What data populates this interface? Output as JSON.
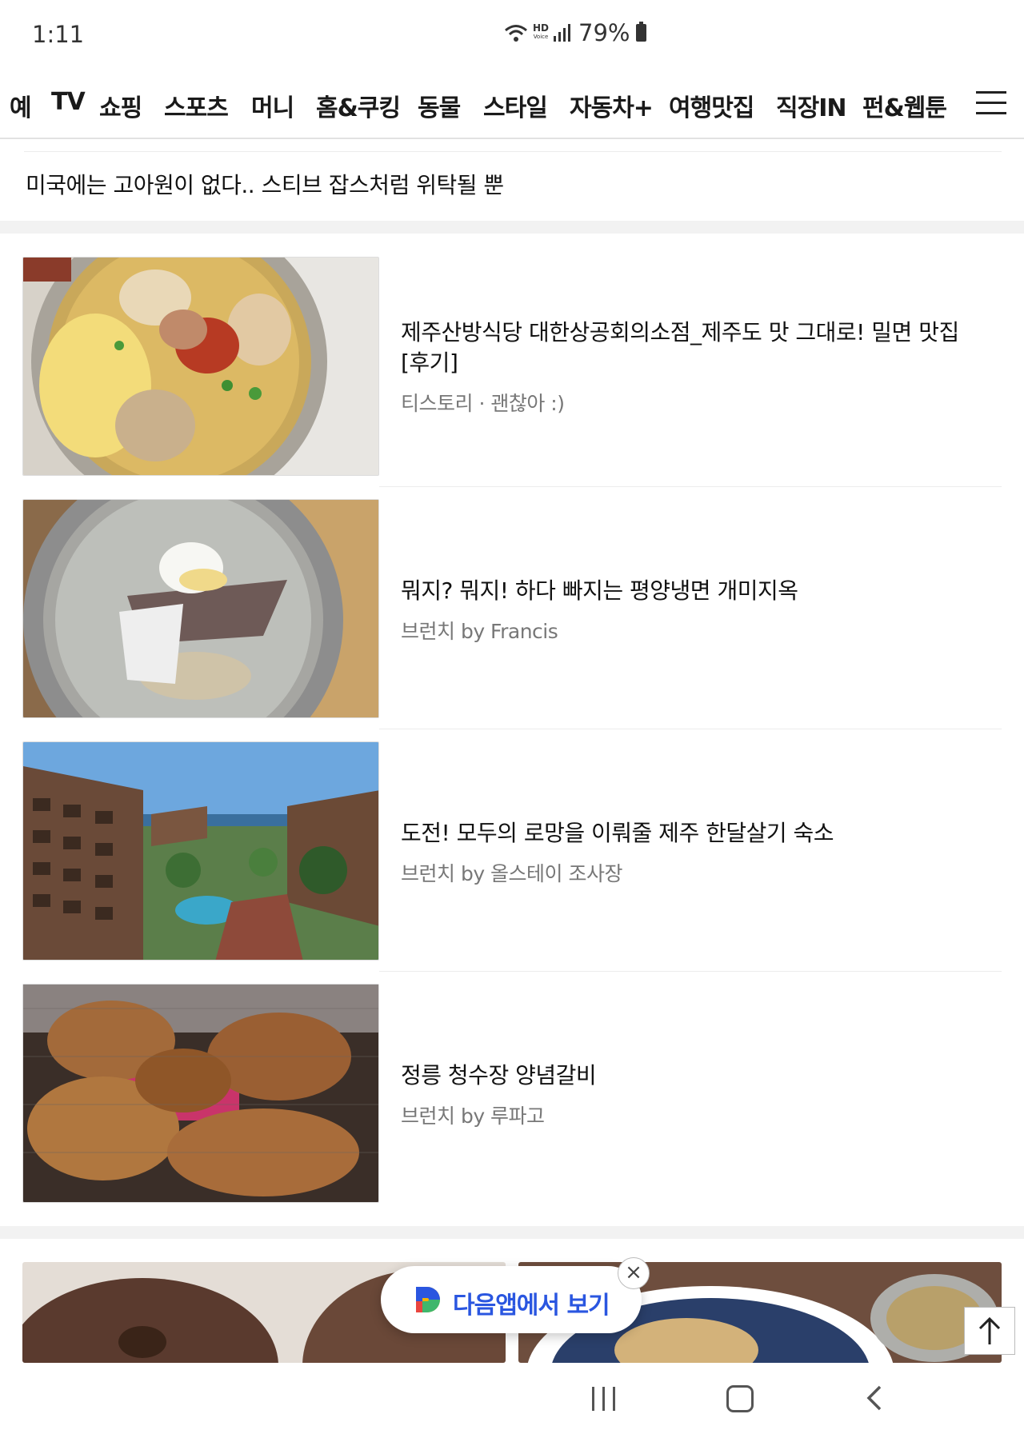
{
  "status_bar": {
    "time": "1:11",
    "hd_label": "HD",
    "hd_sub": "Voice",
    "battery": "79%"
  },
  "nav": {
    "partial_item": "예",
    "items": [
      "TV",
      "쇼핑",
      "스포츠",
      "머니",
      "홈&쿠킹",
      "동물",
      "스타일",
      "자동차+",
      "여행맛집",
      "직장IN",
      "펀&웹툰"
    ],
    "active": "여행맛집",
    "menu_icon": "hamburger-icon"
  },
  "headline": "미국에는 고아원이 없다.. 스티브 잡스처럼 위탁될 뿐",
  "articles": [
    {
      "title": "제주산방식당 대한상공회의소점_제주도 맛 그대로! 밀면 맛집[후기]",
      "source": "티스토리 · 괜찮아 :)",
      "thumb": "naengmyeon-dumpling-soup-photo"
    },
    {
      "title": "뭐지? 뭐지! 하다 빠지는 평양냉면 개미지옥",
      "source": "브런치 by Francis",
      "thumb": "pyongyang-naengmyeon-photo"
    },
    {
      "title": "도전! 모두의 로망을 이뤄줄 제주 한달살기 숙소",
      "source": "브런치 by 올스테이 조사장",
      "thumb": "jeju-resort-photo"
    },
    {
      "title": "정릉 청수장 양념갈비",
      "source": "브런치 by 루파고",
      "thumb": "grilled-galbi-photo"
    }
  ],
  "app_banner": {
    "label": "다음앱에서 보기",
    "logo": "daum-d-logo"
  },
  "icons": {
    "close": "close-icon",
    "scroll_top": "arrow-up-icon",
    "recent": "recent-apps-icon",
    "home": "home-icon",
    "back": "back-icon"
  },
  "colors": {
    "accent": "#2a56e0",
    "active_underline": "#111111",
    "source_text": "#777777"
  }
}
